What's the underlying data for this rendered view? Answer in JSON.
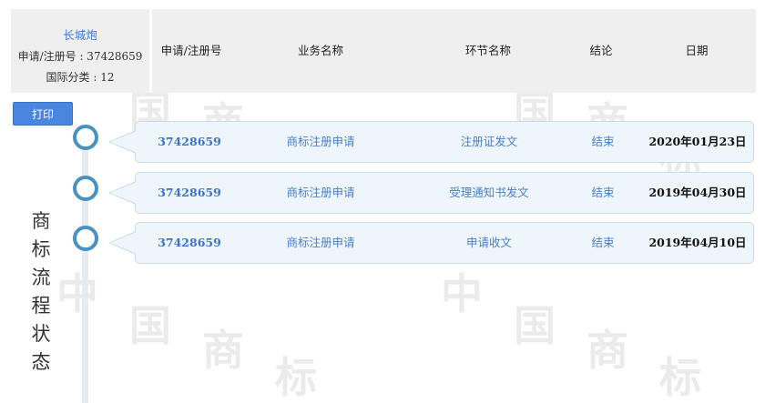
{
  "mark": {
    "name": "长城炮",
    "reg_line": "申请/注册号 : 37428659",
    "class_line": "国际分类 : 12"
  },
  "columns": [
    "申请/注册号",
    "业务名称",
    "环节名称",
    "结论",
    "日期"
  ],
  "print_label": "打印",
  "side_title": [
    "商",
    "标",
    "流",
    "程",
    "状",
    "态"
  ],
  "rows": [
    {
      "number": "37428659",
      "business": "商标注册申请",
      "stage": "注册证发文",
      "result": "结束",
      "date": "2020年01月23日"
    },
    {
      "number": "37428659",
      "business": "商标注册申请",
      "stage": "受理通知书发文",
      "result": "结束",
      "date": "2019年04月30日"
    },
    {
      "number": "37428659",
      "business": "商标注册申请",
      "stage": "申请收文",
      "result": "结束",
      "date": "2019年04月10日"
    }
  ],
  "watermark": [
    "中",
    "国",
    "商",
    "标"
  ],
  "colors": {
    "accent": "#4a86e0",
    "node": "#4a90c0",
    "row_bg": "#eef6fb",
    "header_bg": "#efefef"
  }
}
